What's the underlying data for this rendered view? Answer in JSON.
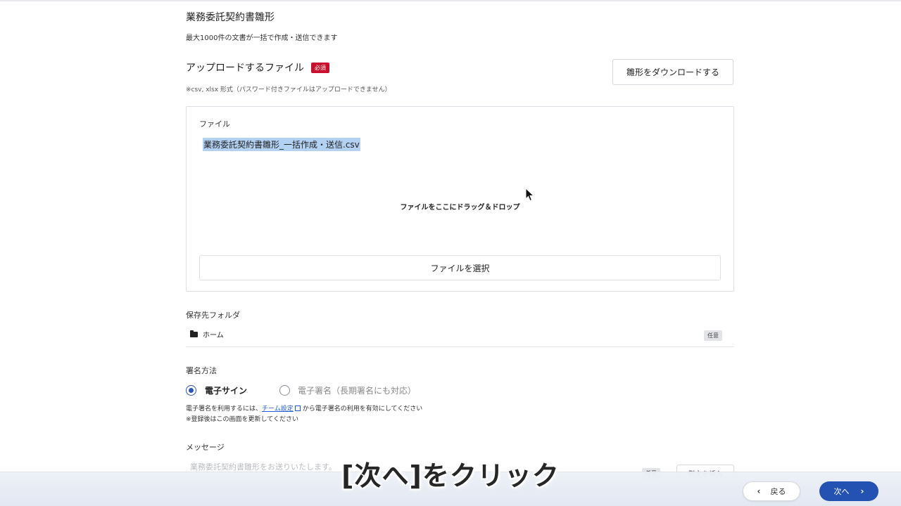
{
  "page": {
    "title": "業務委託契約書雛形",
    "subtitle": "最大1000件の文書が一括で作成・送信できます"
  },
  "upload": {
    "label": "アップロードするファイル",
    "required_badge": "必須",
    "download_button": "雛形をダウンロードする",
    "note": "※csv, xlsx 形式（パスワード付きファイルはアップロードできません）",
    "file_label": "ファイル",
    "file_name": "業務委託契約書雛形_一括作成・送信.csv",
    "drop_text": "ファイルをここにドラッグ＆ドロップ",
    "select_button": "ファイルを選択"
  },
  "folder": {
    "label": "保存先フォルダ",
    "value": "ホーム",
    "optional_badge": "任意",
    "icon": "folder-icon"
  },
  "signature": {
    "label": "署名方法",
    "options": [
      {
        "label": "電子サイン",
        "selected": true
      },
      {
        "label": "電子署名（長期署名にも対応）",
        "selected": false
      }
    ],
    "note_prefix": "電子署名を利用するには、",
    "note_link": "チーム設定",
    "note_suffix": "から電子署名の利用を有効にしてください",
    "note2": "※登録後はこの画面を更新してください"
  },
  "message": {
    "label": "メッセージ",
    "placeholder": "業務委託契約書雛形をお送りいたします。",
    "optional_badge": "任意",
    "example_button": "例文を挿入"
  },
  "caption": "[次へ]をクリック",
  "footer": {
    "back_label": "戻る",
    "next_label": "次へ"
  },
  "colors": {
    "accent": "#2452b3",
    "required": "#c8102e",
    "link": "#1f5bd1",
    "selection": "#b3d1f3"
  }
}
